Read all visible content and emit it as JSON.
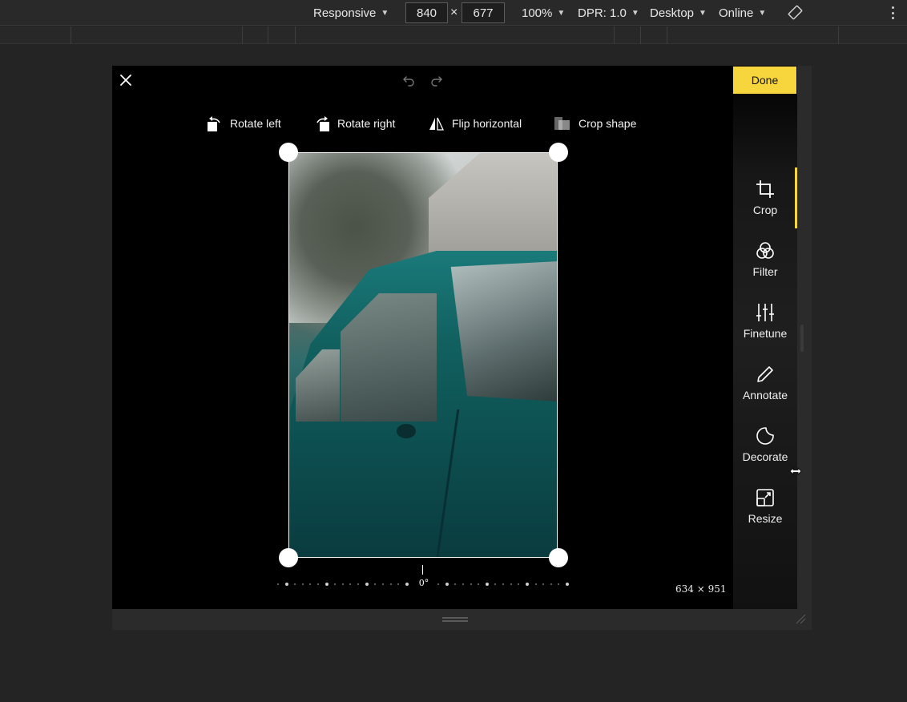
{
  "devtools": {
    "device": "Responsive",
    "width": "840",
    "times": "×",
    "height": "677",
    "zoom": "100%",
    "dpr": "DPR: 1.0",
    "mode": "Desktop",
    "network": "Online"
  },
  "editor": {
    "tools": [
      {
        "label": "Rotate left",
        "icon": "rotate-left-icon"
      },
      {
        "label": "Rotate right",
        "icon": "rotate-right-icon"
      },
      {
        "label": "Flip horizontal",
        "icon": "flip-horizontal-icon"
      },
      {
        "label": "Crop shape",
        "icon": "crop-shape-icon"
      }
    ],
    "rotation_label": "0°",
    "size_label": "634 × 951",
    "done_label": "Done",
    "nav": [
      {
        "label": "Crop",
        "icon": "crop-icon",
        "active": true
      },
      {
        "label": "Filter",
        "icon": "filter-icon"
      },
      {
        "label": "Finetune",
        "icon": "finetune-icon"
      },
      {
        "label": "Annotate",
        "icon": "annotate-icon"
      },
      {
        "label": "Decorate",
        "icon": "decorate-icon"
      },
      {
        "label": "Resize",
        "icon": "resize-icon"
      }
    ]
  },
  "colors": {
    "accent": "#f7d53c",
    "background": "#000000",
    "devtools_bg": "#292929"
  }
}
